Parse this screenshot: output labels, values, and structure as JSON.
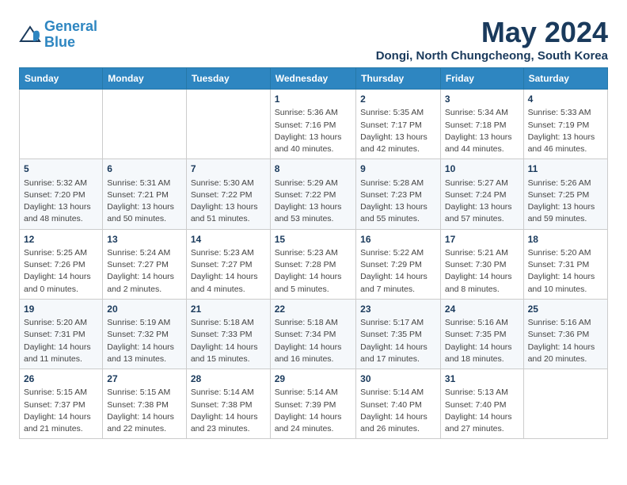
{
  "header": {
    "logo_line1": "General",
    "logo_line2": "Blue",
    "month": "May 2024",
    "location": "Dongi, North Chungcheong, South Korea"
  },
  "weekdays": [
    "Sunday",
    "Monday",
    "Tuesday",
    "Wednesday",
    "Thursday",
    "Friday",
    "Saturday"
  ],
  "weeks": [
    [
      {
        "day": "",
        "info": ""
      },
      {
        "day": "",
        "info": ""
      },
      {
        "day": "",
        "info": ""
      },
      {
        "day": "1",
        "info": "Sunrise: 5:36 AM\nSunset: 7:16 PM\nDaylight: 13 hours\nand 40 minutes."
      },
      {
        "day": "2",
        "info": "Sunrise: 5:35 AM\nSunset: 7:17 PM\nDaylight: 13 hours\nand 42 minutes."
      },
      {
        "day": "3",
        "info": "Sunrise: 5:34 AM\nSunset: 7:18 PM\nDaylight: 13 hours\nand 44 minutes."
      },
      {
        "day": "4",
        "info": "Sunrise: 5:33 AM\nSunset: 7:19 PM\nDaylight: 13 hours\nand 46 minutes."
      }
    ],
    [
      {
        "day": "5",
        "info": "Sunrise: 5:32 AM\nSunset: 7:20 PM\nDaylight: 13 hours\nand 48 minutes."
      },
      {
        "day": "6",
        "info": "Sunrise: 5:31 AM\nSunset: 7:21 PM\nDaylight: 13 hours\nand 50 minutes."
      },
      {
        "day": "7",
        "info": "Sunrise: 5:30 AM\nSunset: 7:22 PM\nDaylight: 13 hours\nand 51 minutes."
      },
      {
        "day": "8",
        "info": "Sunrise: 5:29 AM\nSunset: 7:22 PM\nDaylight: 13 hours\nand 53 minutes."
      },
      {
        "day": "9",
        "info": "Sunrise: 5:28 AM\nSunset: 7:23 PM\nDaylight: 13 hours\nand 55 minutes."
      },
      {
        "day": "10",
        "info": "Sunrise: 5:27 AM\nSunset: 7:24 PM\nDaylight: 13 hours\nand 57 minutes."
      },
      {
        "day": "11",
        "info": "Sunrise: 5:26 AM\nSunset: 7:25 PM\nDaylight: 13 hours\nand 59 minutes."
      }
    ],
    [
      {
        "day": "12",
        "info": "Sunrise: 5:25 AM\nSunset: 7:26 PM\nDaylight: 14 hours\nand 0 minutes."
      },
      {
        "day": "13",
        "info": "Sunrise: 5:24 AM\nSunset: 7:27 PM\nDaylight: 14 hours\nand 2 minutes."
      },
      {
        "day": "14",
        "info": "Sunrise: 5:23 AM\nSunset: 7:27 PM\nDaylight: 14 hours\nand 4 minutes."
      },
      {
        "day": "15",
        "info": "Sunrise: 5:23 AM\nSunset: 7:28 PM\nDaylight: 14 hours\nand 5 minutes."
      },
      {
        "day": "16",
        "info": "Sunrise: 5:22 AM\nSunset: 7:29 PM\nDaylight: 14 hours\nand 7 minutes."
      },
      {
        "day": "17",
        "info": "Sunrise: 5:21 AM\nSunset: 7:30 PM\nDaylight: 14 hours\nand 8 minutes."
      },
      {
        "day": "18",
        "info": "Sunrise: 5:20 AM\nSunset: 7:31 PM\nDaylight: 14 hours\nand 10 minutes."
      }
    ],
    [
      {
        "day": "19",
        "info": "Sunrise: 5:20 AM\nSunset: 7:31 PM\nDaylight: 14 hours\nand 11 minutes."
      },
      {
        "day": "20",
        "info": "Sunrise: 5:19 AM\nSunset: 7:32 PM\nDaylight: 14 hours\nand 13 minutes."
      },
      {
        "day": "21",
        "info": "Sunrise: 5:18 AM\nSunset: 7:33 PM\nDaylight: 14 hours\nand 15 minutes."
      },
      {
        "day": "22",
        "info": "Sunrise: 5:18 AM\nSunset: 7:34 PM\nDaylight: 14 hours\nand 16 minutes."
      },
      {
        "day": "23",
        "info": "Sunrise: 5:17 AM\nSunset: 7:35 PM\nDaylight: 14 hours\nand 17 minutes."
      },
      {
        "day": "24",
        "info": "Sunrise: 5:16 AM\nSunset: 7:35 PM\nDaylight: 14 hours\nand 18 minutes."
      },
      {
        "day": "25",
        "info": "Sunrise: 5:16 AM\nSunset: 7:36 PM\nDaylight: 14 hours\nand 20 minutes."
      }
    ],
    [
      {
        "day": "26",
        "info": "Sunrise: 5:15 AM\nSunset: 7:37 PM\nDaylight: 14 hours\nand 21 minutes."
      },
      {
        "day": "27",
        "info": "Sunrise: 5:15 AM\nSunset: 7:38 PM\nDaylight: 14 hours\nand 22 minutes."
      },
      {
        "day": "28",
        "info": "Sunrise: 5:14 AM\nSunset: 7:38 PM\nDaylight: 14 hours\nand 23 minutes."
      },
      {
        "day": "29",
        "info": "Sunrise: 5:14 AM\nSunset: 7:39 PM\nDaylight: 14 hours\nand 24 minutes."
      },
      {
        "day": "30",
        "info": "Sunrise: 5:14 AM\nSunset: 7:40 PM\nDaylight: 14 hours\nand 26 minutes."
      },
      {
        "day": "31",
        "info": "Sunrise: 5:13 AM\nSunset: 7:40 PM\nDaylight: 14 hours\nand 27 minutes."
      },
      {
        "day": "",
        "info": ""
      }
    ]
  ]
}
